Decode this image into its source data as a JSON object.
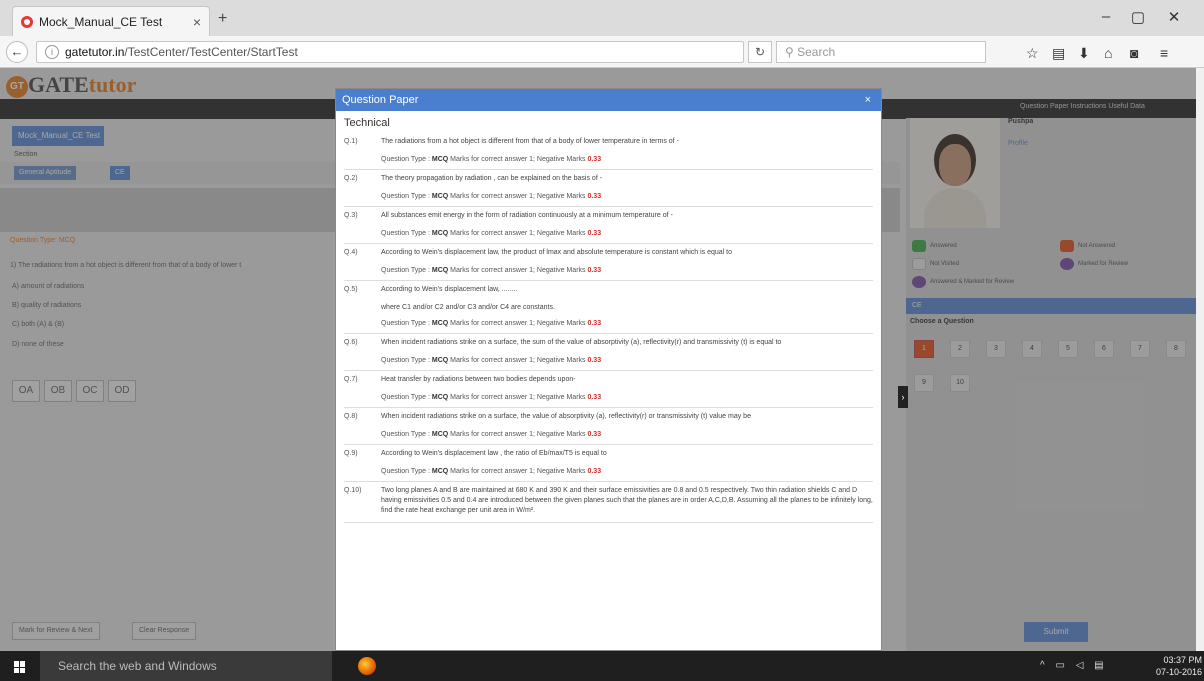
{
  "browser": {
    "tab_title": "Mock_Manual_CE Test",
    "url_domain": "gatetutor.in",
    "url_path": "/TestCenter/TestCenter/StartTest",
    "search_placeholder": "Search"
  },
  "app": {
    "logo_gate": "GATE",
    "logo_tutor": "tutor",
    "logo_badge": "GT",
    "legend_top": "Question Paper   Instructions   Useful Data",
    "test_name": "Mock_Manual_CE Test",
    "section_label": "Section",
    "sections": [
      "General Aptitude",
      "CE"
    ],
    "question_type": "Question Type: MCQ",
    "question_text": "1) The radiations from a hot object is different from that of a body of lower t",
    "options": [
      "A) amount of radiations",
      "B) quality of radiations",
      "C) both (A) & (B)",
      "D) none of these"
    ],
    "radio_labels": [
      "OA",
      "OB",
      "OC",
      "OD"
    ],
    "mark_review_btn": "Mark for Review & Next",
    "clear_btn": "Clear Response",
    "user_name": "Pushpa",
    "profile_link": "Profile",
    "legend": [
      "Answered",
      "Not Answered",
      "Not Visited",
      "Marked for Review",
      "Answered & Marked for Review"
    ],
    "section_bar": "CE",
    "choose_question": "Choose a Question",
    "question_numbers": [
      "1",
      "2",
      "3",
      "4",
      "5",
      "6",
      "7",
      "8",
      "9",
      "10"
    ],
    "submit_btn": "Submit"
  },
  "modal": {
    "title": "Question Paper",
    "close": "×",
    "section": "Technical",
    "meta_prefix": "Question Type : ",
    "meta_type": "MCQ",
    "meta_marks": " Marks for correct answer 1; Negative Marks ",
    "meta_negative": "0.33",
    "questions": [
      {
        "num": "Q.1)",
        "text": "The radiations from a hot object is different from that of a body of lower temperature in terms of -"
      },
      {
        "num": "Q.2)",
        "text": "The theory propagation by radiation , can be explained on the basis of -"
      },
      {
        "num": "Q.3)",
        "text": "All substances emit energy in the form of radiation continuously at a minimum temperature of -"
      },
      {
        "num": "Q.4)",
        "text": "According to Wein's displacement law, the product of lmax and absolute temperature is constant which is equal to"
      },
      {
        "num": "Q.5)",
        "text": "According to Wein's displacement law, ........",
        "extra": "where C1 and/or C2 and/or C3 and/or C4 are constants."
      },
      {
        "num": "Q.6)",
        "text": "When incident radiations strike on a surface, the sum of the value of absorptivity (a), reflectivity(r) and transmissivity (t) is equal to"
      },
      {
        "num": "Q.7)",
        "text": "Heat transfer by radiations between two bodies depends upon-"
      },
      {
        "num": "Q.8)",
        "text": "When incident radiations strike on a surface, the value of absorptivity (a), reflectivity(r) or transmissivity (t) value may be"
      },
      {
        "num": "Q.9)",
        "text": "According to Wein's displacement law , the ratio of Eb/max/T5 is equal to"
      },
      {
        "num": "Q.10)",
        "text": "Two long planes A and B are maintained at 680 K and 390 K and their surface emissivities are 0.8 and 0.5 respectively. Two thin radiation shields C and D having emissivities 0.5 and 0.4 are introduced between the given planes such that the planes are in order A,C,D,B. Assuming all the planes to be infinitely long, find the rate heat exchange per unit area in W/m²."
      }
    ]
  },
  "taskbar": {
    "search_placeholder": "Search the web and Windows",
    "time": "03:37 PM",
    "date": "07-10-2016"
  }
}
